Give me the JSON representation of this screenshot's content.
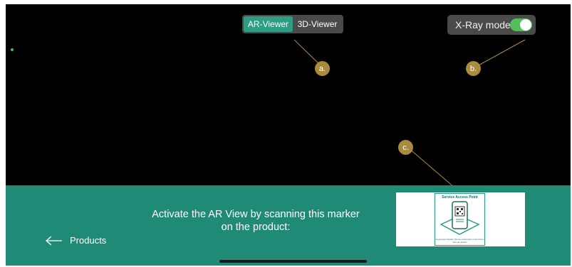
{
  "viewer_switch": {
    "options": [
      {
        "label": "AR-Viewer",
        "active": true
      },
      {
        "label": "3D-Viewer",
        "active": false
      }
    ]
  },
  "xray": {
    "label": "X-Ray mode",
    "enabled": true
  },
  "callouts": {
    "a": "a.",
    "b": "b.",
    "c": "c."
  },
  "instruction": {
    "line1": "Activate the AR View by scanning this marker",
    "line2": "on the product:"
  },
  "back": {
    "label": "Products",
    "icon": "arrow-left-icon"
  },
  "marker": {
    "title": "Service Access Point",
    "footer": "Augmented Reality Service Information Instructions Remote Expert"
  },
  "colors": {
    "accent": "#1f8a76",
    "segment_active": "#2f9c84",
    "callout": "#a98b3d",
    "toggle_on": "#52c05a"
  }
}
